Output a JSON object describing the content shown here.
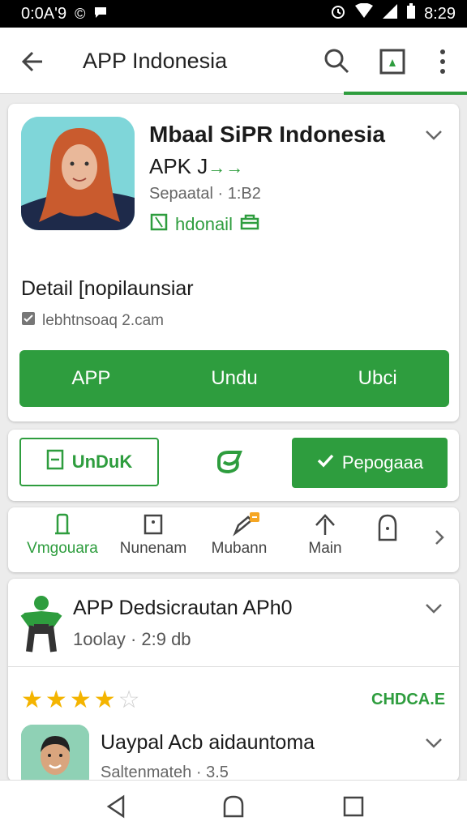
{
  "status_bar": {
    "left_text": "0:0A'9",
    "time": "8:29"
  },
  "app_bar": {
    "title": "APP Indonesia",
    "icons": [
      "back-arrow-icon",
      "search-icon",
      "frame-icon",
      "more-vert-icon"
    ],
    "accent": "#2e9d3e"
  },
  "hero": {
    "app_name": "Mbaal SiPR Indonesia",
    "subtitle": "APK J",
    "subtitle_accent": "→→",
    "meta": "Sepaatal · 1:B2",
    "developer": "hdonail",
    "section_title": "Detail [nopilaunsiar",
    "section_meta": "lebhtnsoaq 2.cam",
    "green_bar": [
      "APP",
      "Undu",
      "Ubci"
    ]
  },
  "actions": {
    "outline_label": "UnDuK",
    "solid_label": "Pepogaaa"
  },
  "tabs": [
    {
      "label": "Vmgouara",
      "icon": "bookmark-icon"
    },
    {
      "label": "Nunenam",
      "icon": "square-icon"
    },
    {
      "label": "Mubann",
      "icon": "pen-icon",
      "badge": true
    },
    {
      "label": "Main",
      "icon": "upload-icon"
    },
    {
      "label": "",
      "icon": "lock-icon"
    }
  ],
  "list": {
    "item1": {
      "title": "APP Dedsicrautan APh0",
      "meta": "1oolay · 2:9  db"
    },
    "rating": {
      "stars": 4,
      "max": 5,
      "label": "CHDCA.E"
    },
    "item2": {
      "title": "Uaypal Acb aidauntoma",
      "meta": "Saltenmateh · 3.5"
    }
  },
  "colors": {
    "green": "#2e9d3e",
    "star": "#f4b400"
  }
}
